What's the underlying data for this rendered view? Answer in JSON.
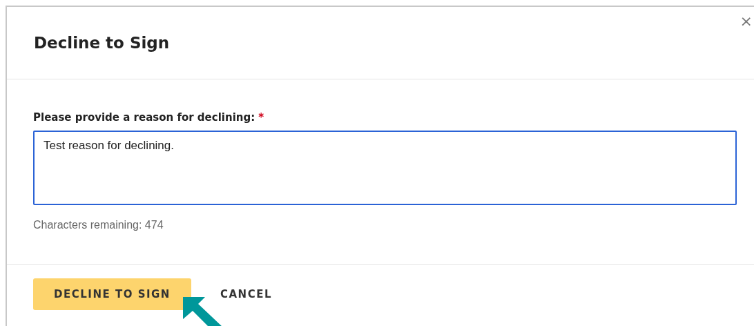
{
  "dialog": {
    "title": "Decline to Sign",
    "close": "×"
  },
  "reason": {
    "label": "Please provide a reason for declining:",
    "required_mark": "*",
    "value": "Test reason for declining."
  },
  "counter": "Characters remaining: 474",
  "buttons": [
    {
      "label": "DECLINE TO SIGN",
      "kind": "primary"
    },
    {
      "label": "CANCEL",
      "kind": "text"
    }
  ]
}
